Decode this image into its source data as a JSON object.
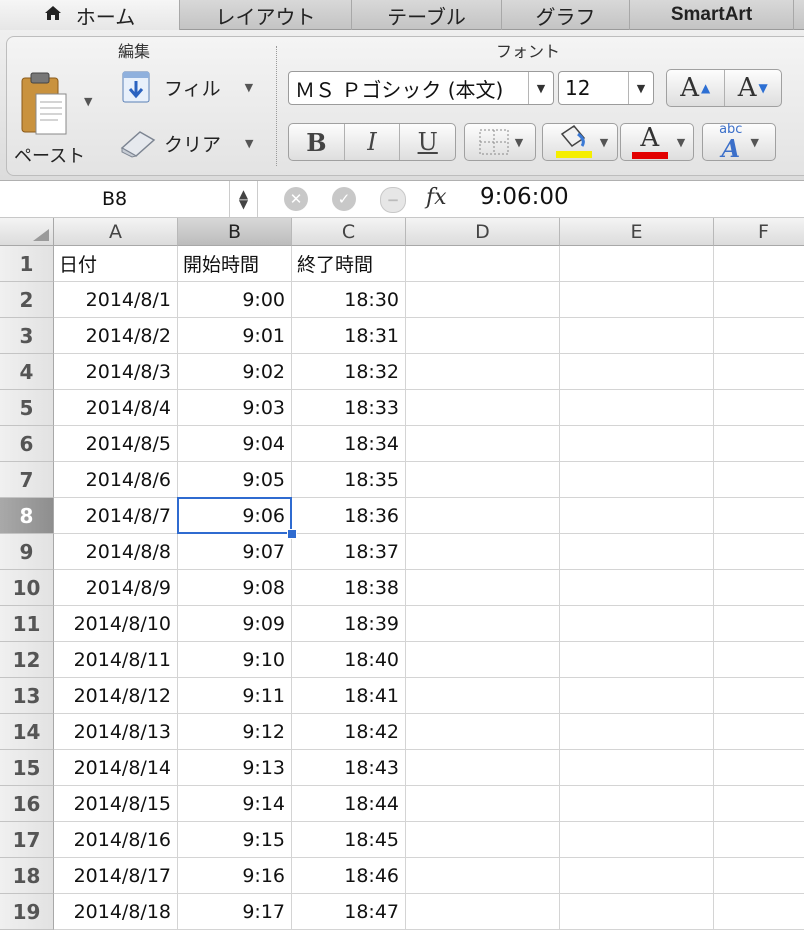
{
  "tabs": [
    {
      "label": "ホーム",
      "active": true
    },
    {
      "label": "レイアウト"
    },
    {
      "label": "テーブル"
    },
    {
      "label": "グラフ"
    },
    {
      "label": "SmartArt"
    }
  ],
  "ribbon": {
    "edit_group": "編集",
    "font_group": "フォント",
    "paste_label": "ペースト",
    "fill_label": "フィル",
    "clear_label": "クリア",
    "font_name": "ＭＳ Ｐゴシック (本文)",
    "font_size": "12",
    "grow_font": "A",
    "shrink_font": "A",
    "bold": "B",
    "italic": "I",
    "underline": "U",
    "font_color_letter": "A",
    "text_effects_top": "abc",
    "text_effects_letter": "A",
    "colors": {
      "highlight": "#f5ee00",
      "font_color": "#e20000"
    }
  },
  "formula_bar": {
    "name_box": "B8",
    "fx": "fx",
    "value": "9:06:00"
  },
  "columns": [
    "A",
    "B",
    "C",
    "D",
    "E",
    "F"
  ],
  "selected_column": "B",
  "selected_row": "8",
  "rows": [
    {
      "n": "1",
      "a": "日付",
      "b": "開始時間",
      "c": "終了時間"
    },
    {
      "n": "2",
      "a": "2014/8/1",
      "b": "9:00",
      "c": "18:30"
    },
    {
      "n": "3",
      "a": "2014/8/2",
      "b": "9:01",
      "c": "18:31"
    },
    {
      "n": "4",
      "a": "2014/8/3",
      "b": "9:02",
      "c": "18:32"
    },
    {
      "n": "5",
      "a": "2014/8/4",
      "b": "9:03",
      "c": "18:33"
    },
    {
      "n": "6",
      "a": "2014/8/5",
      "b": "9:04",
      "c": "18:34"
    },
    {
      "n": "7",
      "a": "2014/8/6",
      "b": "9:05",
      "c": "18:35"
    },
    {
      "n": "8",
      "a": "2014/8/7",
      "b": "9:06",
      "c": "18:36"
    },
    {
      "n": "9",
      "a": "2014/8/8",
      "b": "9:07",
      "c": "18:37"
    },
    {
      "n": "10",
      "a": "2014/8/9",
      "b": "9:08",
      "c": "18:38"
    },
    {
      "n": "11",
      "a": "2014/8/10",
      "b": "9:09",
      "c": "18:39"
    },
    {
      "n": "12",
      "a": "2014/8/11",
      "b": "9:10",
      "c": "18:40"
    },
    {
      "n": "13",
      "a": "2014/8/12",
      "b": "9:11",
      "c": "18:41"
    },
    {
      "n": "14",
      "a": "2014/8/13",
      "b": "9:12",
      "c": "18:42"
    },
    {
      "n": "15",
      "a": "2014/8/14",
      "b": "9:13",
      "c": "18:43"
    },
    {
      "n": "16",
      "a": "2014/8/15",
      "b": "9:14",
      "c": "18:44"
    },
    {
      "n": "17",
      "a": "2014/8/16",
      "b": "9:15",
      "c": "18:45"
    },
    {
      "n": "18",
      "a": "2014/8/17",
      "b": "9:16",
      "c": "18:46"
    },
    {
      "n": "19",
      "a": "2014/8/18",
      "b": "9:17",
      "c": "18:47"
    }
  ]
}
